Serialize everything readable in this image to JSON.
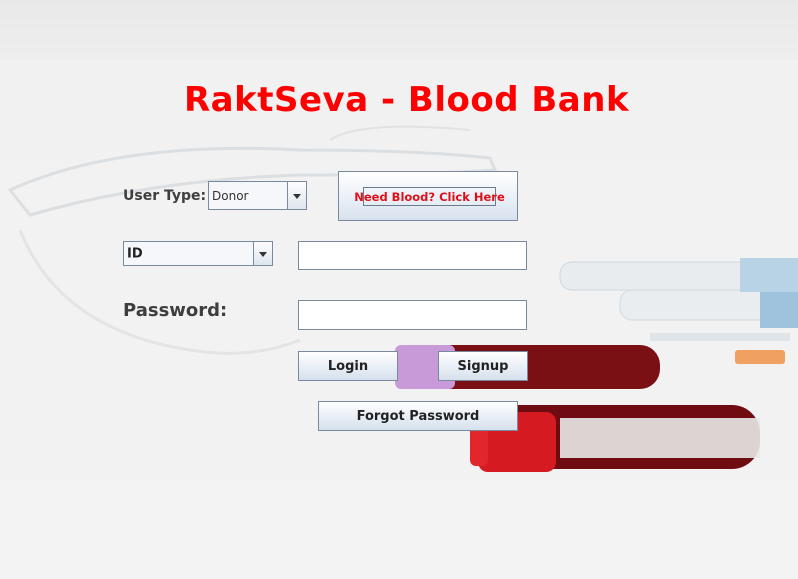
{
  "window": {
    "title": "RaktSeva - Blood Bank"
  },
  "form": {
    "user_type_label": "User Type:",
    "user_type_value": "Donor",
    "need_blood_label": "Need Blood? Click Here",
    "id_type_value": "ID",
    "id_value": "",
    "password_label": "Password:",
    "password_value": ""
  },
  "actions": {
    "login_label": "Login",
    "signup_label": "Signup",
    "forgot_label": "Forgot Password"
  },
  "colors": {
    "title": "#ff0000",
    "need_blood_text": "#e0101a",
    "label": "#3e3e3e"
  }
}
